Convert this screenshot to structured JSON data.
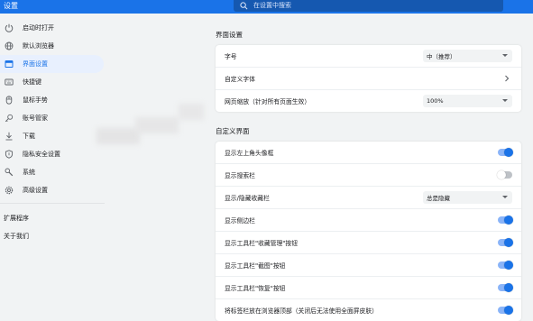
{
  "topbar": {
    "title": "设置",
    "search_placeholder": "在设置中搜索"
  },
  "sidebar": {
    "items": [
      {
        "label": "启动时打开",
        "icon": "power-icon",
        "active": false
      },
      {
        "label": "默认浏览器",
        "icon": "globe-icon",
        "active": false
      },
      {
        "label": "界面设置",
        "icon": "window-icon",
        "active": true
      },
      {
        "label": "快捷键",
        "icon": "keyboard-icon",
        "active": false
      },
      {
        "label": "鼠标手势",
        "icon": "mouse-icon",
        "active": false
      },
      {
        "label": "账号管家",
        "icon": "key-icon",
        "active": false
      },
      {
        "label": "下载",
        "icon": "download-icon",
        "active": false
      },
      {
        "label": "隐私安全设置",
        "icon": "shield-icon",
        "active": false
      },
      {
        "label": "系统",
        "icon": "wrench-icon",
        "active": false
      },
      {
        "label": "高级设置",
        "icon": "gear-icon",
        "active": false
      }
    ],
    "extensions": "扩展程序",
    "about": "关于我们"
  },
  "interface_section": {
    "title": "界面设置",
    "font_size_label": "字号",
    "font_size_value": "中（推荐）",
    "custom_font_label": "自定义字体",
    "page_zoom_label": "网页缩放（针对所有页面生效）",
    "page_zoom_value": "100%"
  },
  "custom_section": {
    "title": "自定义界面",
    "rows": [
      {
        "label": "显示左上角头像框",
        "type": "toggle",
        "on": true
      },
      {
        "label": "显示搜索栏",
        "type": "toggle",
        "on": false
      },
      {
        "label": "显示/隐藏收藏栏",
        "type": "select",
        "value": "总是隐藏"
      },
      {
        "label": "显示侧边栏",
        "type": "toggle",
        "on": true
      },
      {
        "label": "显示工具栏\"收藏管理\"按钮",
        "type": "toggle",
        "on": true
      },
      {
        "label": "显示工具栏\"截图\"按钮",
        "type": "toggle",
        "on": true
      },
      {
        "label": "显示工具栏\"恢复\"按钮",
        "type": "toggle",
        "on": true
      },
      {
        "label": "将标签栏放在浏览器顶部（关闭后无法使用全面屏皮肤）",
        "type": "toggle",
        "on": true
      }
    ]
  },
  "colors": {
    "accent": "#1a73e8",
    "toggle_track_on": "#8ab4f8",
    "toggle_track_off": "#bdc1c6",
    "background": "#f1f3f4"
  }
}
